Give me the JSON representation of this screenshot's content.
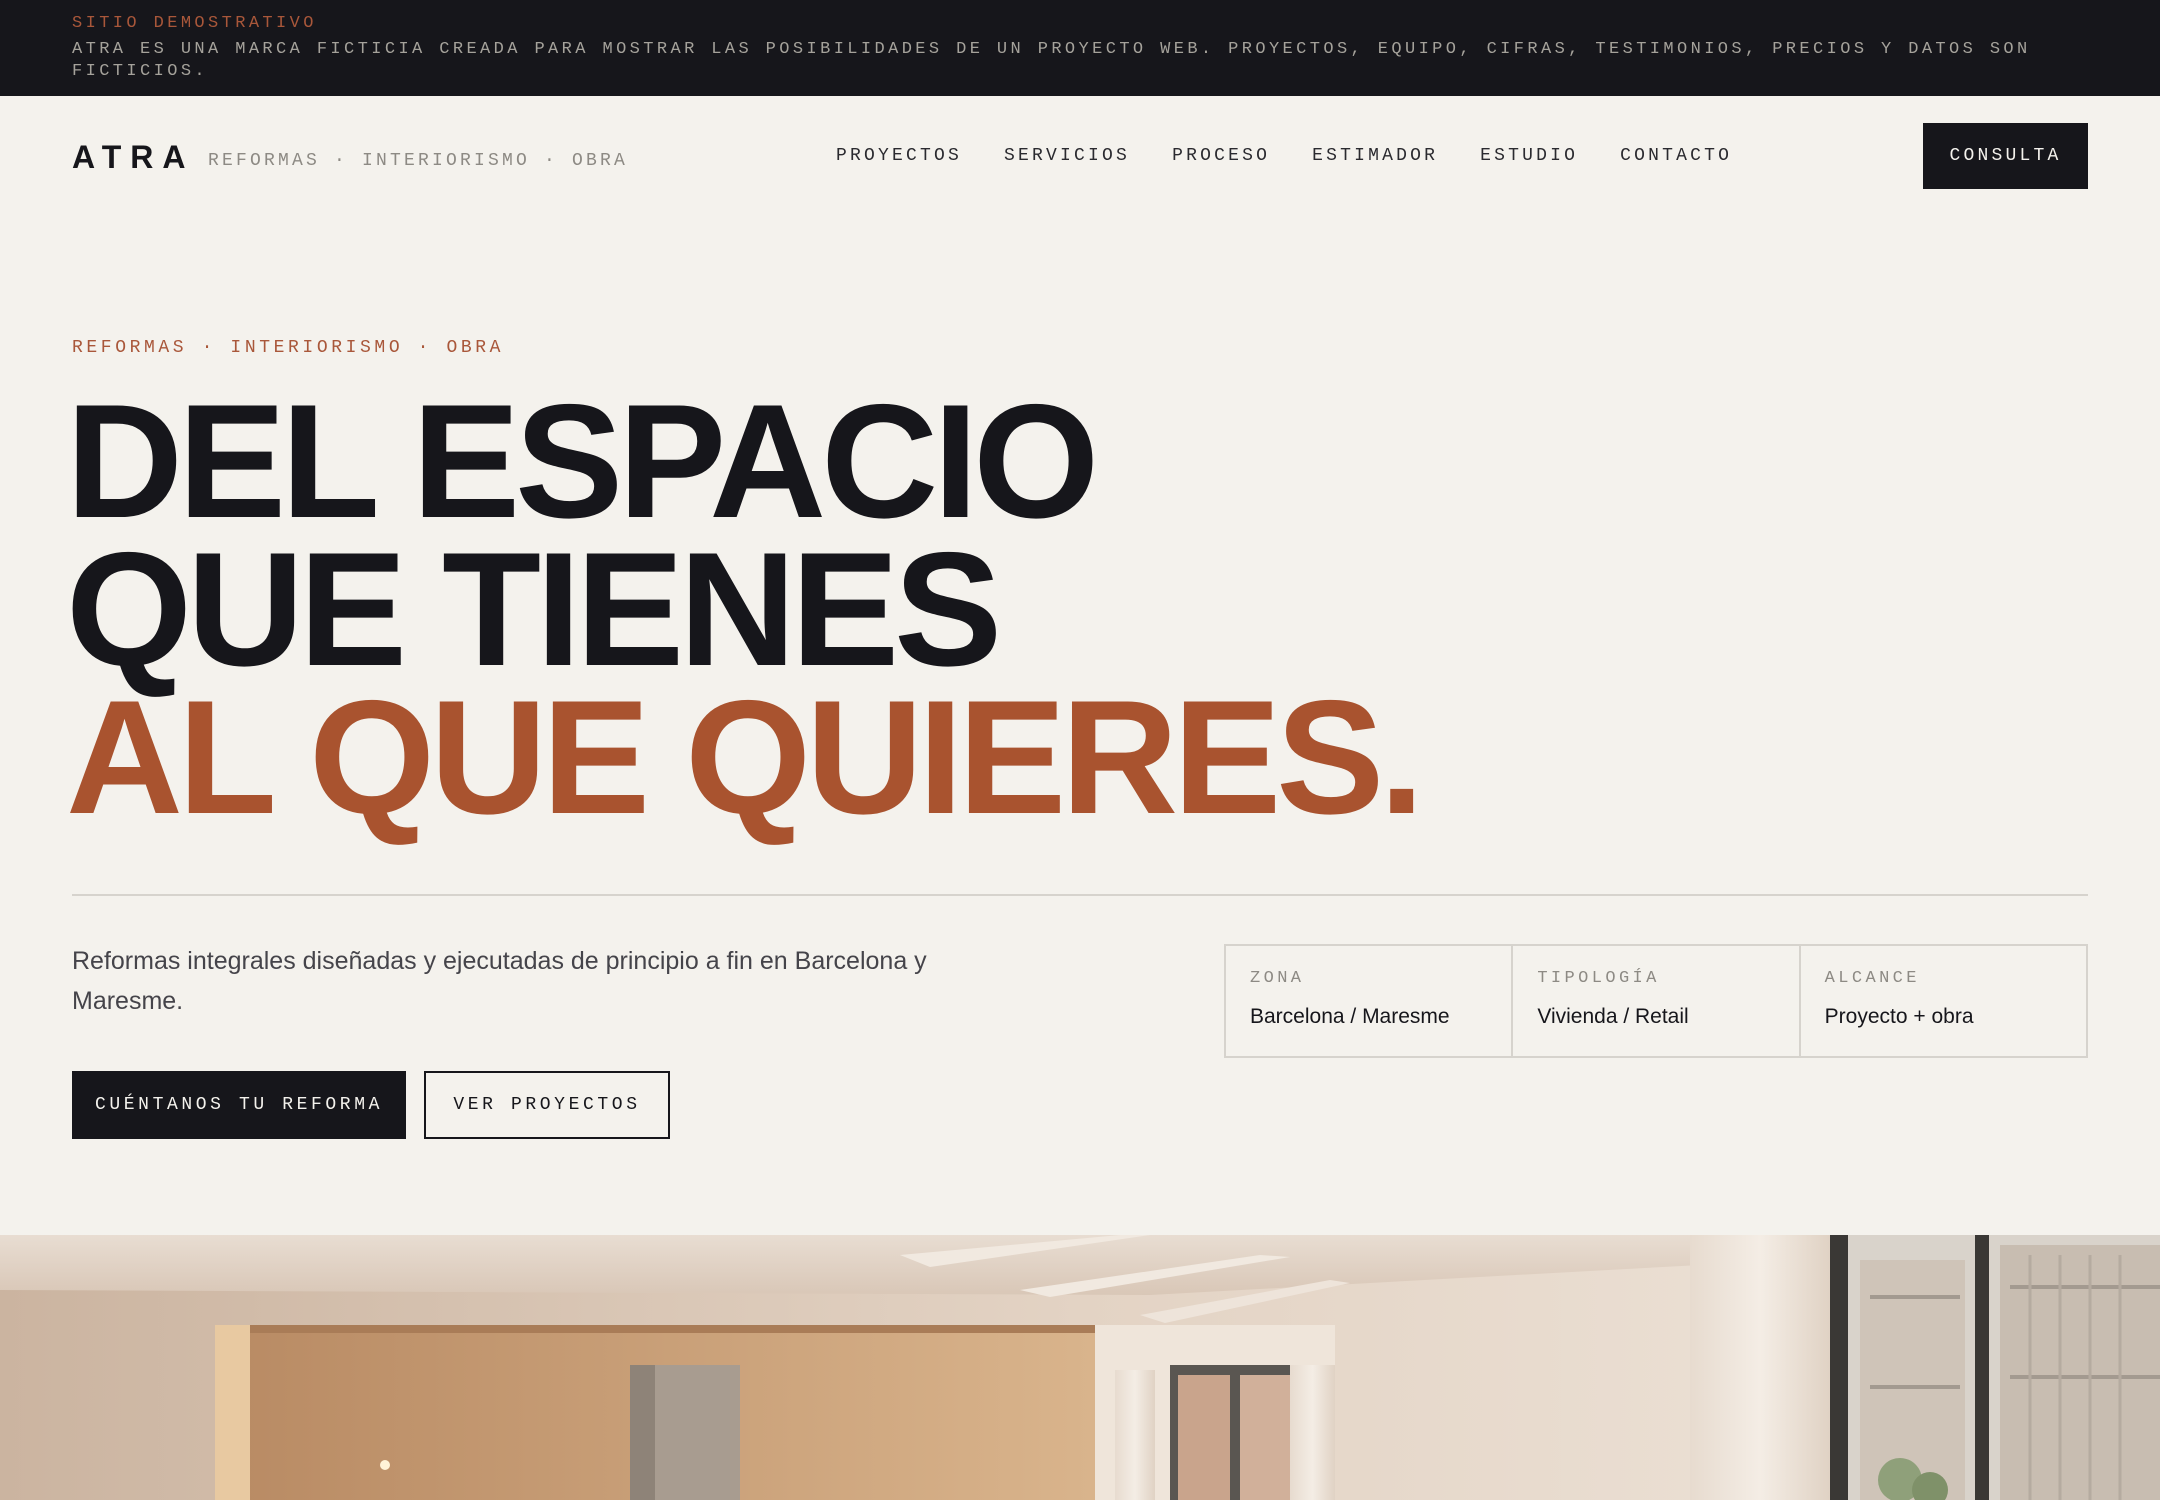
{
  "demo_banner": {
    "title": "SITIO DEMOSTRATIVO",
    "text": "ATRA ES UNA MARCA FICTICIA CREADA PARA MOSTRAR LAS POSIBILIDADES DE UN PROYECTO WEB. PROYECTOS, EQUIPO, CIFRAS, TESTIMONIOS, PRECIOS Y DATOS SON FICTICIOS."
  },
  "header": {
    "logo": "ATRA",
    "tagline": "REFORMAS · INTERIORISMO · OBRA",
    "nav": [
      {
        "label": "PROYECTOS"
      },
      {
        "label": "SERVICIOS"
      },
      {
        "label": "PROCESO"
      },
      {
        "label": "ESTIMADOR"
      },
      {
        "label": "ESTUDIO"
      },
      {
        "label": "CONTACTO"
      }
    ],
    "cta_label": "CONSULTA"
  },
  "hero": {
    "eyebrow": "REFORMAS · INTERIORISMO · OBRA",
    "headline_line1": "DEL ESPACIO",
    "headline_line2": "QUE TIENES",
    "headline_line3": "AL QUE QUIERES.",
    "intro": "Reformas integrales diseñadas y ejecutadas de principio a fin en Barcelona y Maresme.",
    "primary_button": "CUÉNTANOS TU REFORMA",
    "secondary_button": "VER PROYECTOS",
    "facts": [
      {
        "label": "ZONA",
        "value": "Barcelona / Maresme"
      },
      {
        "label": "TIPOLOGÍA",
        "value": "Vivienda / Retail"
      },
      {
        "label": "ALCANCE",
        "value": "Proyecto + obra"
      }
    ]
  },
  "colors": {
    "background": "#f4f2ed",
    "ink": "#16161b",
    "accent": "#a9532f"
  }
}
